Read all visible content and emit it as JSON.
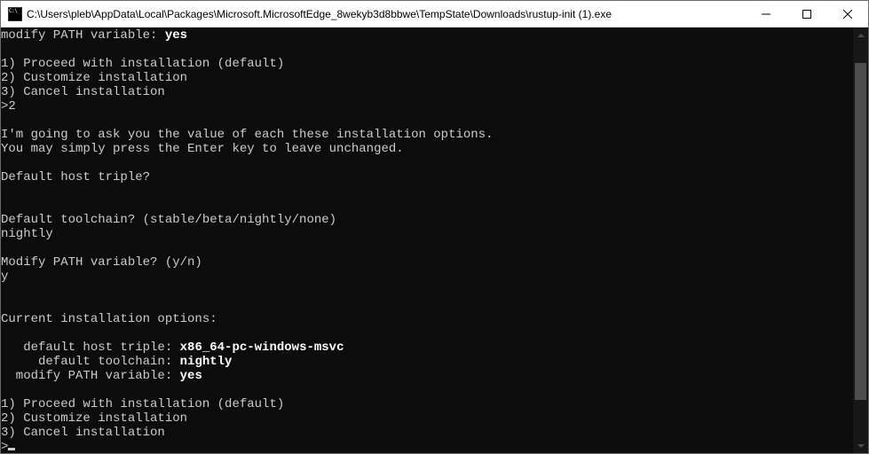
{
  "window": {
    "title": "C:\\Users\\pleb\\AppData\\Local\\Packages\\Microsoft.MicrosoftEdge_8wekyb3d8bbwe\\TempState\\Downloads\\rustup-init (1).exe"
  },
  "terminal": {
    "prev_modify_label": "modify PATH variable: ",
    "prev_modify_value": "yes",
    "menu1_opt1": "1) Proceed with installation (default)",
    "menu1_opt2": "2) Customize installation",
    "menu1_opt3": "3) Cancel installation",
    "menu1_prompt": ">2",
    "ask_l1": "I'm going to ask you the value of each these installation options.",
    "ask_l2": "You may simply press the Enter key to leave unchanged.",
    "q_host": "Default host triple?",
    "a_host": "",
    "q_toolchain": "Default toolchain? (stable/beta/nightly/none)",
    "a_toolchain": "nightly",
    "q_path": "Modify PATH variable? (y/n)",
    "a_path": "y",
    "current_header": "Current installation options:",
    "cur_host_label": "   default host triple: ",
    "cur_host_value": "x86_64-pc-windows-msvc",
    "cur_toolchain_label": "     default toolchain: ",
    "cur_toolchain_value": "nightly",
    "cur_path_label": "  modify PATH variable: ",
    "cur_path_value": "yes",
    "menu2_opt1": "1) Proceed with installation (default)",
    "menu2_opt2": "2) Customize installation",
    "menu2_opt3": "3) Cancel installation",
    "menu2_prompt": ">"
  }
}
